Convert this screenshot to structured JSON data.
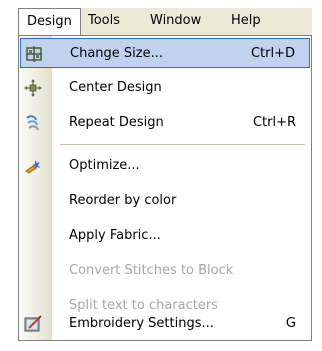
{
  "menubar": {
    "design": "Design",
    "tools": "Tools",
    "window": "Window",
    "help": "Help"
  },
  "menu": {
    "items": [
      {
        "label": "Change Size...",
        "shortcut": "Ctrl+D"
      },
      {
        "label": "Center Design",
        "shortcut": ""
      },
      {
        "label": "Repeat Design",
        "shortcut": "Ctrl+R"
      },
      {
        "label": "Optimize...",
        "shortcut": ""
      },
      {
        "label": "Reorder by color",
        "shortcut": ""
      },
      {
        "label": "Apply Fabric...",
        "shortcut": ""
      },
      {
        "label": "Convert Stitches to Block",
        "shortcut": ""
      },
      {
        "label": "Split text to characters",
        "shortcut": ""
      },
      {
        "label": "Embroidery Settings...",
        "shortcut": "G"
      }
    ]
  },
  "colors": {
    "highlight_bg": "#c1d2ee",
    "highlight_border": "#316ac5",
    "disabled_text": "#a7a6aa",
    "menubar_bg": "#ece9d8"
  }
}
